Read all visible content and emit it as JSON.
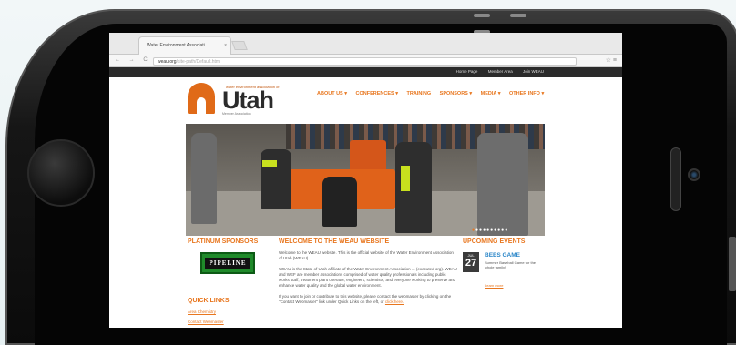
{
  "browser": {
    "tab_title": "Water Environment Associati...",
    "tab_close": "×",
    "url": "weau.org",
    "url_rest": "/site-path/Default.html",
    "nav_icons": "← → C",
    "menu_icons": "☆ ≡"
  },
  "topbar": {
    "links": [
      "Home Page",
      "Member Area",
      "Join WEAU"
    ]
  },
  "logo": {
    "small_text": "water environment association of",
    "main_text": "Utah",
    "tagline": "Member Association"
  },
  "nav": {
    "items": [
      "ABOUT US ▾",
      "CONFERENCES ▾",
      "TRAINING",
      "SPONSORS ▾",
      "MEDIA ▾",
      "OTHER INFO ▾"
    ]
  },
  "sponsors": {
    "heading": "PLATINUM SPONSORS",
    "logo_text": "PIPELINE"
  },
  "quick_links": {
    "heading": "QUICK LINKS",
    "links": [
      "Area Chemistry",
      "Contact Webmaster"
    ]
  },
  "welcome": {
    "heading": "WELCOME TO THE WEAU WEBSITE",
    "p1": "Welcome to the WEAU website. This is the official website of the Water Environment Association of Utah (WEAU).",
    "p2": "WEAU is the State of Utah affiliate of the Water Environment Association ... (executed org). WEAU and WEF are member associations comprised of water quality professionals including public works staff, treatment plant operator, engineers, scientists, and everyone working to preserve and enhance water quality and the global water environment.",
    "p3_a": "If you want to join or contribute to this website, please contact the webmaster by clicking on the \"Contact Webmaster\" link under Quick Links on the left, or ",
    "p3_link": "click here."
  },
  "events": {
    "heading": "UPCOMING EVENTS",
    "items": [
      {
        "month": "JUL",
        "day": "27",
        "title": "BEES GAME",
        "desc": "Summer Baseball Game for the whole family!"
      }
    ],
    "more": "Learn more"
  },
  "colors": {
    "accent": "#e8761e",
    "dark": "#2b2b2b",
    "event_title": "#2a86c8"
  }
}
